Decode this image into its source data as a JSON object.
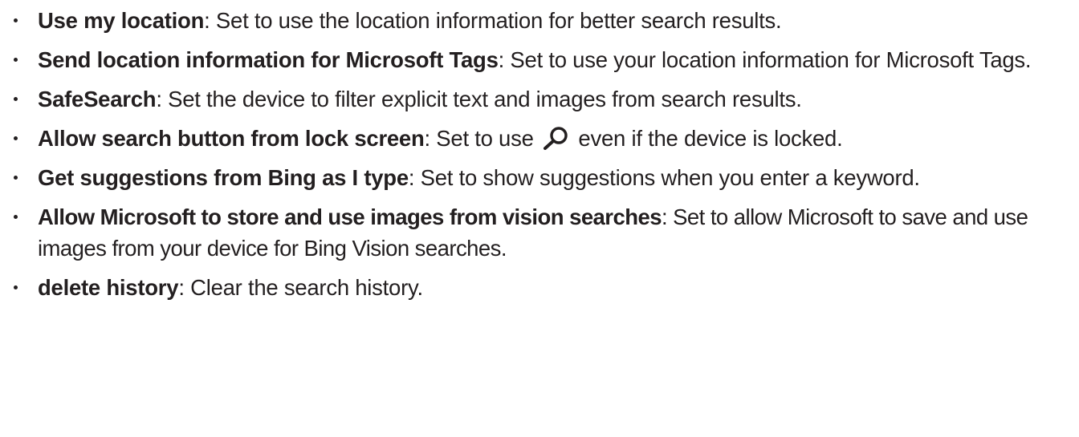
{
  "items": [
    {
      "term": "Use my location",
      "separator": ":",
      "desc": " Set to use the location information for better search results."
    },
    {
      "term": "Send location information for Microsoft Tags",
      "separator": ":",
      "desc": " Set to use your location information for Microsoft Tags."
    },
    {
      "term": "SafeSearch",
      "separator": ":",
      "desc": " Set the device to filter explicit text and images from search results."
    },
    {
      "term": "Allow search button from lock screen",
      "separator": ":",
      "desc_before_icon": " Set to use ",
      "icon": "search-icon",
      "desc_after_icon": " even if the device is locked."
    },
    {
      "term": "Get suggestions from Bing as I type",
      "separator": ":",
      "desc": " Set to show suggestions when you enter a keyword."
    },
    {
      "term": "Allow Microsoft to store and use images from vision searches",
      "separator": ":",
      "desc": " Set to allow Microsoft to save and use images from your device for Bing Vision searches."
    },
    {
      "term": "delete history",
      "separator": ":",
      "desc": " Clear the search history."
    }
  ],
  "colors": {
    "text": "#231f20",
    "background": "#ffffff"
  }
}
